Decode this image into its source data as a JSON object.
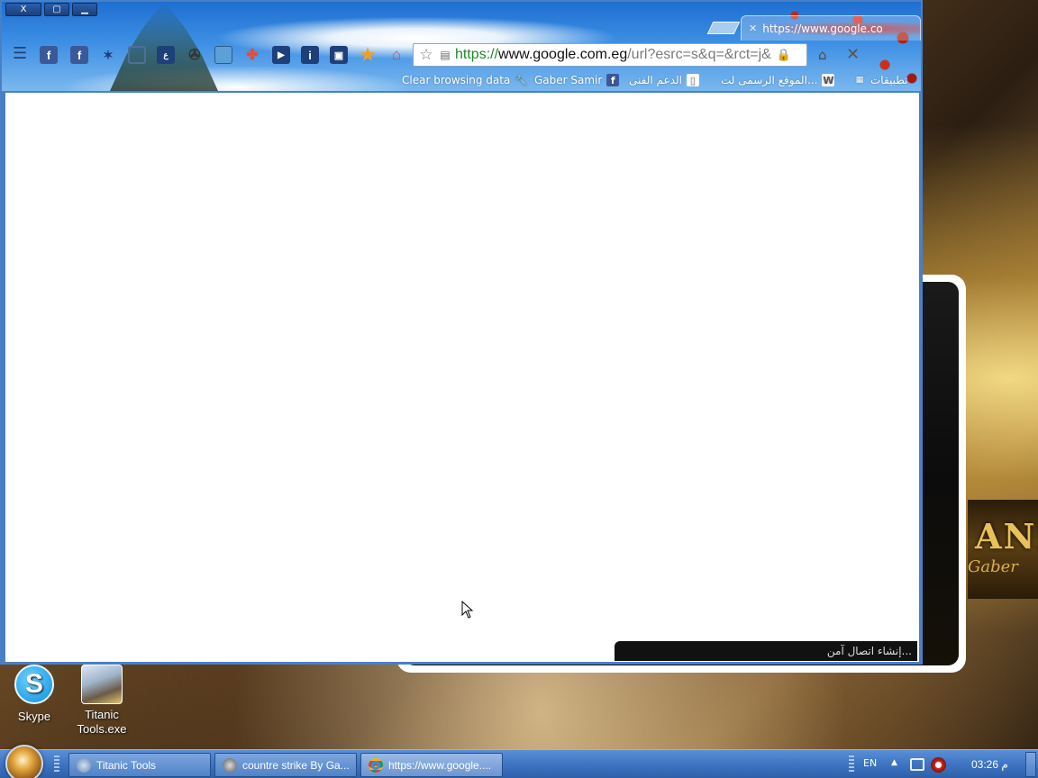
{
  "browser": {
    "tab_title": "https://www.google.co",
    "window_controls": {
      "close": "X",
      "maximize": "▢",
      "minimize": "▁"
    },
    "url": {
      "scheme": "https://",
      "host": "www.google.com.eg",
      "path": "/url?esrc=s&q=&rct=j&"
    },
    "extensions": [
      "facebook-icon",
      "facebook-icon",
      "extension-icon",
      "extension-icon",
      "extension-icon",
      "film-reel-icon",
      "extension-icon",
      "pinwheel-icon",
      "video-icon",
      "extension-icon",
      "video-icon",
      "star-icon",
      "home-icon"
    ],
    "bookmarks": [
      {
        "label": "تطبيقات",
        "icon": "apps-icon"
      },
      {
        "label": "الموقع الرسمى لت...",
        "icon": "w-icon"
      },
      {
        "label": "الدعم الفنى",
        "icon": "page-icon"
      },
      {
        "label": "Gaber Samir",
        "icon": "facebook-icon"
      },
      {
        "label": "Clear browsing data",
        "icon": "wrench-icon"
      }
    ],
    "status_text": "إنشاء اتصال آمن..."
  },
  "background_app": {
    "banner_title": "ANI",
    "banner_sub": "Gaber"
  },
  "desktop_icons": [
    {
      "label": "Skype"
    },
    {
      "label": "Titanic Tools.exe"
    }
  ],
  "taskbar": {
    "tasks": [
      {
        "label": "Titanic Tools"
      },
      {
        "label": "countre strike By Ga..."
      },
      {
        "label": "https://www.google...."
      }
    ],
    "tray_lang": "EN",
    "clock": "03:26 م"
  },
  "colors": {
    "frame": "#4b7fc4",
    "url_scheme": "#1f8a2a",
    "taskbar": "#3e74c2"
  }
}
